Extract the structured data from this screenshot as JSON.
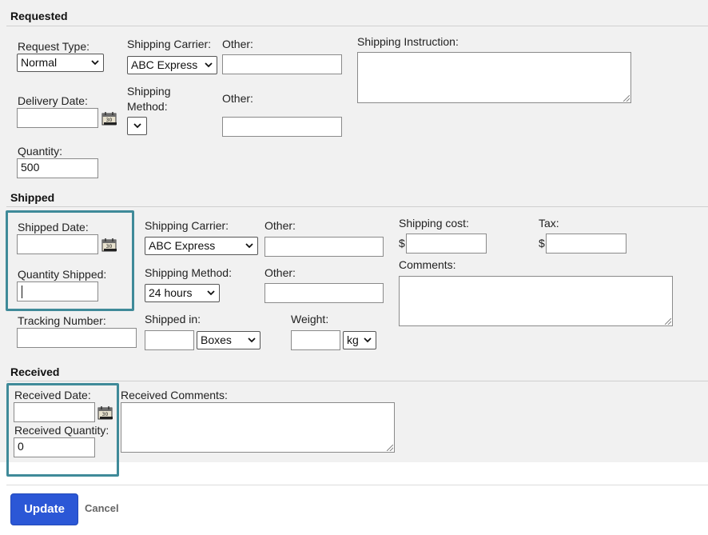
{
  "sections": {
    "requested": "Requested",
    "shipped": "Shipped",
    "received": "Received"
  },
  "requested": {
    "request_type_label": "Request Type:",
    "request_type_value": "Normal",
    "carrier_label": "Shipping Carrier:",
    "carrier_value": "ABC Express",
    "carrier_other_label": "Other:",
    "carrier_other_value": "",
    "instruction_label": "Shipping Instruction:",
    "instruction_value": "",
    "delivery_date_label": "Delivery Date:",
    "delivery_date_value": "",
    "method_label_1": "Shipping",
    "method_label_2": "Method:",
    "method_value": "",
    "method_other_label": "Other:",
    "method_other_value": "",
    "quantity_label": "Quantity:",
    "quantity_value": "500"
  },
  "shipped": {
    "date_label": "Shipped Date:",
    "date_value": "",
    "carrier_label": "Shipping Carrier:",
    "carrier_value": "ABC Express",
    "carrier_other_label": "Other:",
    "carrier_other_value": "",
    "cost_label": "Shipping cost:",
    "cost_currency": "$",
    "cost_value": "",
    "tax_label": "Tax:",
    "tax_currency": "$",
    "tax_value": "",
    "qty_label": "Quantity Shipped:",
    "qty_value": "",
    "method_label": "Shipping Method:",
    "method_value": "24 hours",
    "method_other_label": "Other:",
    "method_other_value": "",
    "comments_label": "Comments:",
    "comments_value": "",
    "tracking_label": "Tracking Number:",
    "tracking_value": "",
    "shipped_in_label": "Shipped in:",
    "shipped_in_value": "",
    "shipped_in_unit": "Boxes",
    "weight_label": "Weight:",
    "weight_value": "",
    "weight_unit": "kg"
  },
  "received": {
    "date_label": "Received Date:",
    "date_value": "",
    "comments_label": "Received Comments:",
    "comments_value": "",
    "qty_label": "Received Quantity:",
    "qty_value": "0"
  },
  "actions": {
    "update_label": "Update",
    "cancel_label": "Cancel"
  },
  "colors": {
    "panel_bg": "#f1f1f1",
    "highlight": "#3f8a99",
    "primary_button": "#2b57d6"
  }
}
